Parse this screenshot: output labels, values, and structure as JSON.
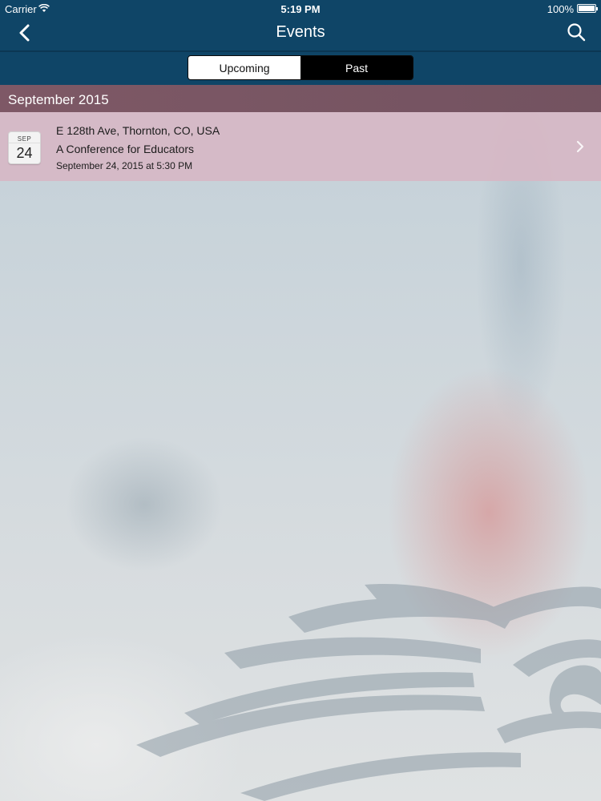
{
  "status_bar": {
    "carrier": "Carrier",
    "time": "5:19 PM",
    "battery": "100%"
  },
  "nav": {
    "title": "Events",
    "back_icon": "chevron-left-icon",
    "search_icon": "search-icon"
  },
  "segments": {
    "upcoming": "Upcoming",
    "past": "Past",
    "selected": "Upcoming"
  },
  "sections": [
    {
      "header": "September 2015",
      "events": [
        {
          "badge_month": "SEP",
          "badge_day": "24",
          "location": "E 128th Ave, Thornton, CO, USA",
          "title": "A Conference for Educators",
          "datetime": "September 24, 2015 at 5:30 PM"
        }
      ]
    }
  ],
  "colors": {
    "nav_bar": "#0f4567",
    "section_header": "#784e5c",
    "event_row": "#d7b6c4"
  }
}
